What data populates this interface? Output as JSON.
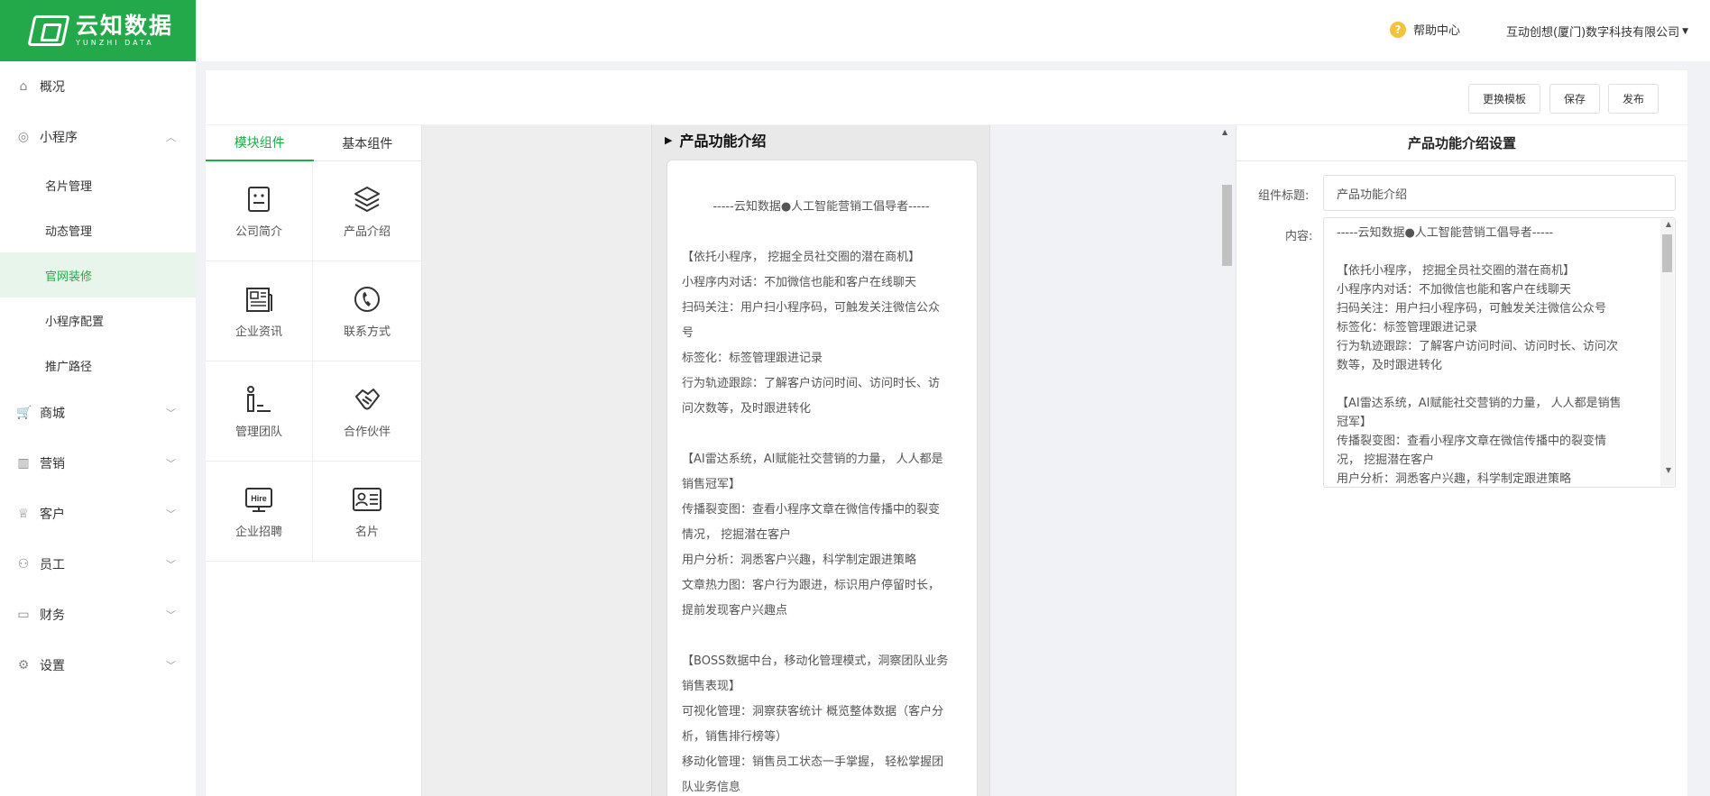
{
  "brand": {
    "name_cn": "云知数据",
    "name_en": "YUNZHI DATA"
  },
  "header": {
    "help": "帮助中心",
    "company": "互动创想(厦门)数字科技有限公司"
  },
  "sidebar": {
    "items": [
      {
        "label": "概况",
        "icon": "home-icon"
      },
      {
        "label": "小程序",
        "icon": "compass-icon",
        "expanded": true,
        "children": [
          "名片管理",
          "动态管理",
          "官网装修",
          "小程序配置",
          "推广路径"
        ],
        "active_child": "官网装修"
      },
      {
        "label": "商城",
        "icon": "cart-icon"
      },
      {
        "label": "营销",
        "icon": "chart-icon"
      },
      {
        "label": "客户",
        "icon": "trophy-icon"
      },
      {
        "label": "员工",
        "icon": "users-icon"
      },
      {
        "label": "财务",
        "icon": "wallet-icon"
      },
      {
        "label": "设置",
        "icon": "gear-icon"
      }
    ]
  },
  "toolbar": {
    "change_template": "更换模板",
    "save": "保存",
    "publish": "发布"
  },
  "components": {
    "tabs": [
      "模块组件",
      "基本组件"
    ],
    "active_tab": "模块组件",
    "items": [
      {
        "label": "公司简介",
        "icon": "company-icon"
      },
      {
        "label": "产品介绍",
        "icon": "layers-icon"
      },
      {
        "label": "企业资讯",
        "icon": "news-icon"
      },
      {
        "label": "联系方式",
        "icon": "phone-icon"
      },
      {
        "label": "管理团队",
        "icon": "team-icon"
      },
      {
        "label": "合作伙伴",
        "icon": "handshake-icon"
      },
      {
        "label": "企业招聘",
        "icon": "hire-icon",
        "icon_text": "Hire"
      },
      {
        "label": "名片",
        "icon": "card-icon"
      }
    ]
  },
  "preview": {
    "title": "产品功能介绍",
    "lines": [
      "-----云知数据●人工智能营销工倡导者-----",
      "",
      "【依托小程序， 挖掘全员社交圈的潜在商机】",
      "小程序内对话：不加微信也能和客户在线聊天",
      "扫码关注：用户扫小程序码，可触发关注微信公众",
      "号",
      "标签化：标签管理跟进记录",
      "行为轨迹跟踪：了解客户访问时间、访问时长、访",
      "问次数等，及时跟进转化",
      "",
      "【AI雷达系统，AI赋能社交营销的力量， 人人都是",
      "销售冠军】",
      "传播裂变图：查看小程序文章在微信传播中的裂变",
      "情况， 挖掘潜在客户",
      "用户分析：洞悉客户兴趣，科学制定跟进策略",
      "文章热力图：客户行为跟进，标识用户停留时长，",
      "提前发现客户兴趣点",
      "",
      "【BOSS数据中台，移动化管理模式，洞察团队业务",
      "销售表现】",
      "可视化管理：洞察获客统计 概览整体数据（客户分",
      "析，销售排行榜等）",
      "移动化管理：销售员工状态一手掌握， 轻松掌握团",
      "队业务信息"
    ]
  },
  "settings": {
    "title": "产品功能介绍设置",
    "title_label": "组件标题:",
    "title_value": "产品功能介绍",
    "content_label": "内容:",
    "content_lines": [
      "-----云知数据●人工智能营销工倡导者-----",
      "",
      "【依托小程序， 挖掘全员社交圈的潜在商机】",
      "小程序内对话：不加微信也能和客户在线聊天",
      "扫码关注：用户扫小程序码，可触发关注微信公众号",
      "标签化：标签管理跟进记录",
      "行为轨迹跟踪：了解客户访问时间、访问时长、访问次",
      "数等，及时跟进转化",
      "",
      "【AI雷达系统，AI赋能社交营销的力量， 人人都是销售",
      "冠军】",
      "传播裂变图：查看小程序文章在微信传播中的裂变情",
      "况， 挖掘潜在客户",
      "用户分析：洞悉客户兴趣，科学制定跟进策略"
    ]
  },
  "colors": {
    "brand_green": "#24a94a",
    "active_bg": "#e7f5ea"
  }
}
